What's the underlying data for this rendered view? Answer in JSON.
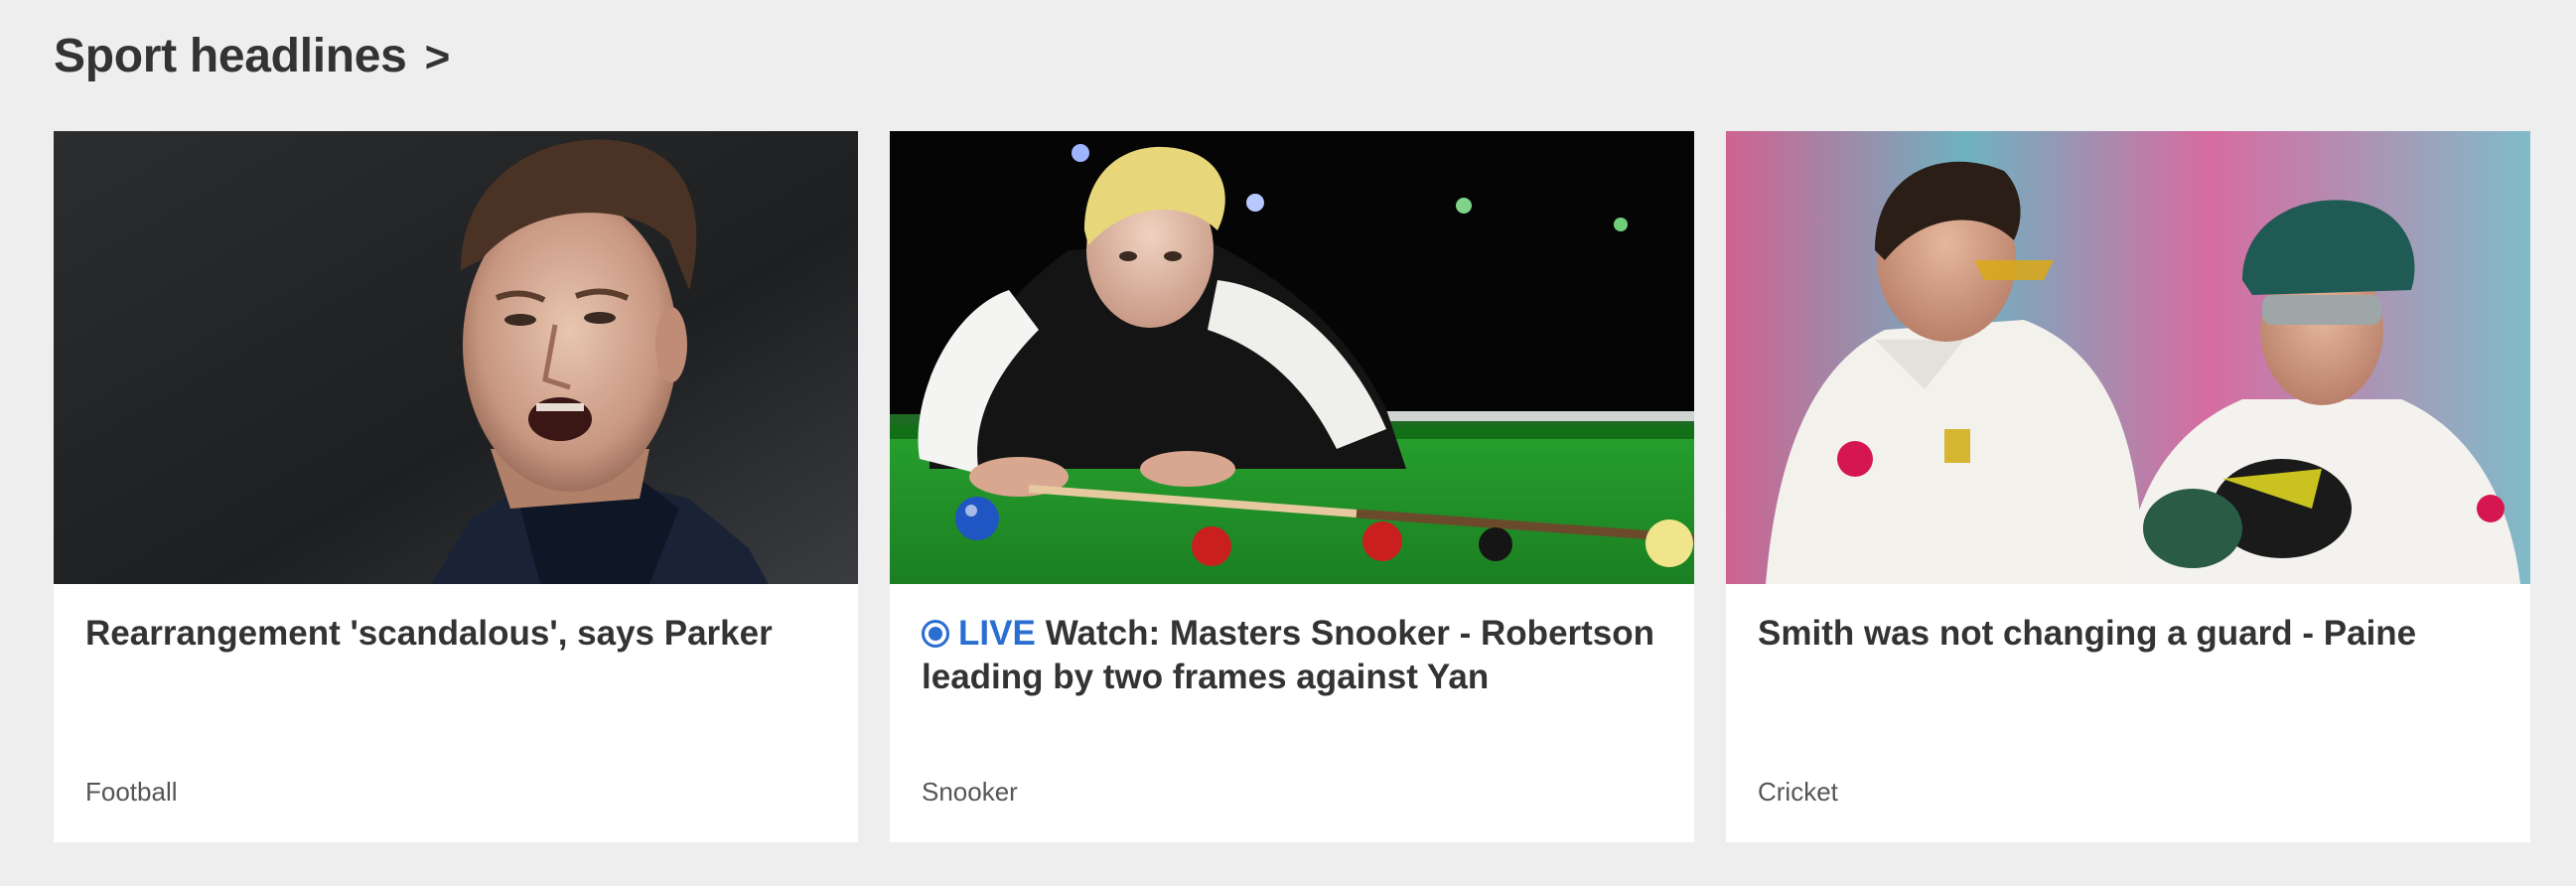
{
  "section": {
    "title": "Sport headlines",
    "chevron": ">"
  },
  "cards": [
    {
      "title": "Rearrangement 'scandalous', says Parker",
      "tag": "Football",
      "image": "football-manager-photo"
    },
    {
      "live_label": "LIVE",
      "title": "Watch: Masters Snooker - Robertson leading by two frames against Yan",
      "tag": "Snooker",
      "image": "snooker-player-photo"
    },
    {
      "title": "Smith was not changing a guard - Paine",
      "tag": "Cricket",
      "image": "cricket-players-photo"
    }
  ],
  "colors": {
    "background": "#eeeeee",
    "card": "#ffffff",
    "text": "#333333",
    "live": "#2a6ed1",
    "tag": "#555555"
  }
}
